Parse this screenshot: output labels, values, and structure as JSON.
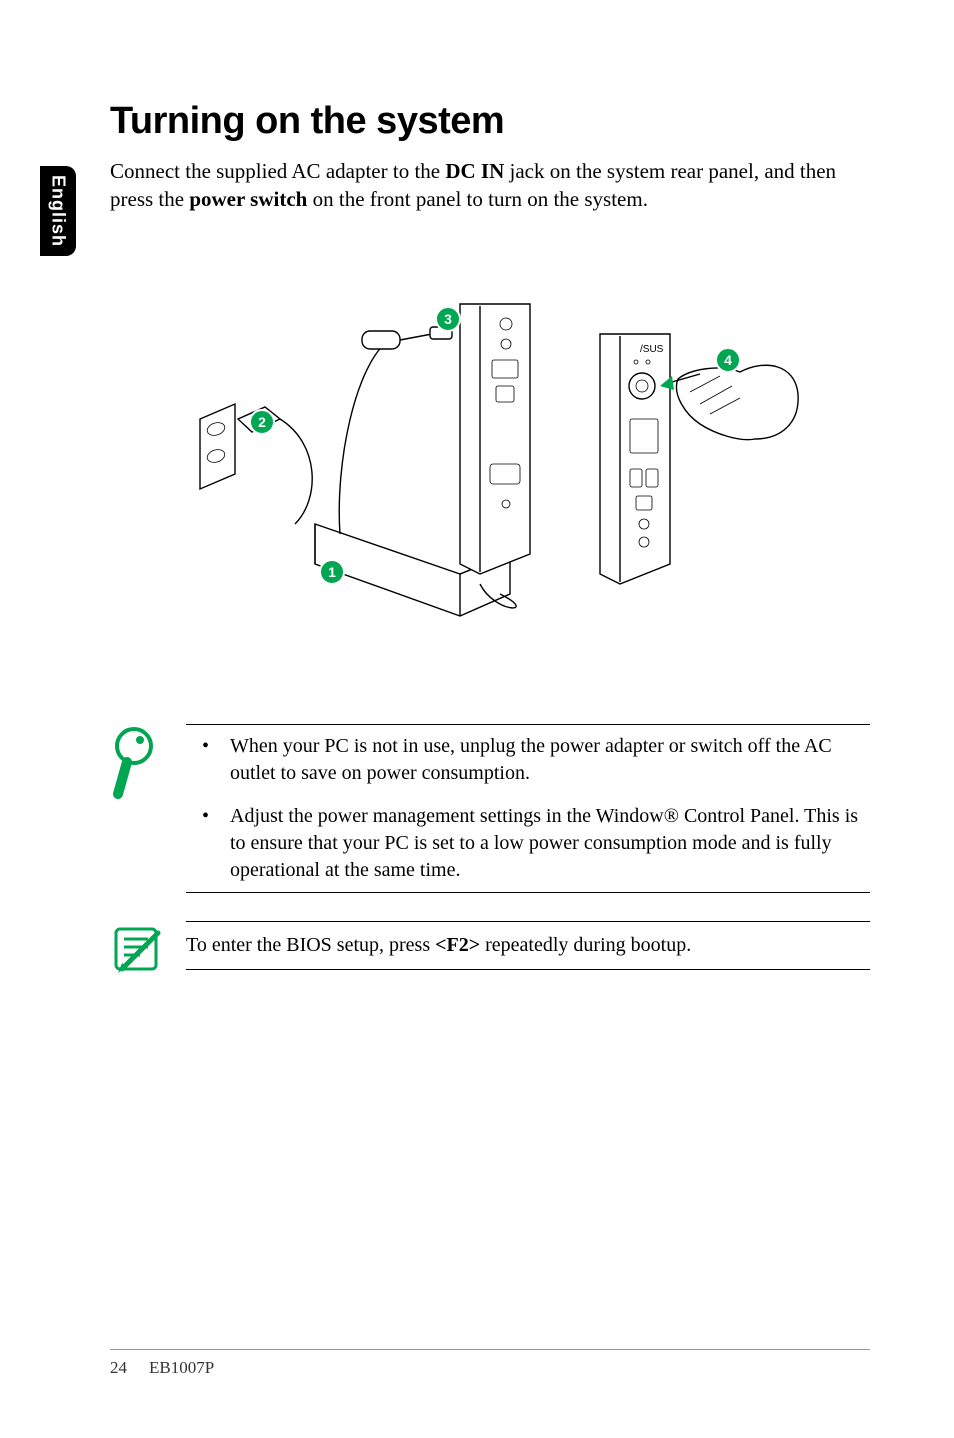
{
  "side_tab": "English",
  "heading": "Turning on the system",
  "intro_parts": {
    "p1": "Connect the supplied AC adapter to the ",
    "b1": "DC IN",
    "p2": " jack on the system rear panel, and then press the ",
    "b2": "power switch",
    "p3": " on the front panel to turn on the system."
  },
  "diagram": {
    "labels": {
      "1": "1",
      "2": "2",
      "3": "3",
      "4": "4"
    },
    "icons": {
      "adapter": "ac-adapter",
      "outlet": "wall-outlet",
      "rear": "device-rear-panel",
      "front": "device-front-panel",
      "hand": "hand-pressing",
      "brand": "/SUS"
    }
  },
  "tips": {
    "bullet1": "When your PC is not in use, unplug the power adapter or switch off the AC outlet to save on power consumption.",
    "bullet2": "Adjust the power management settings in the Window® Control Panel. This is to ensure that your PC is set to a low power consumption mode and is fully operational at the same time."
  },
  "bios_note": {
    "p1": "To enter the BIOS setup, press ",
    "b1": "<F2>",
    "p2": " repeatedly during bootup."
  },
  "footer": {
    "page": "24",
    "model": "EB1007P"
  }
}
